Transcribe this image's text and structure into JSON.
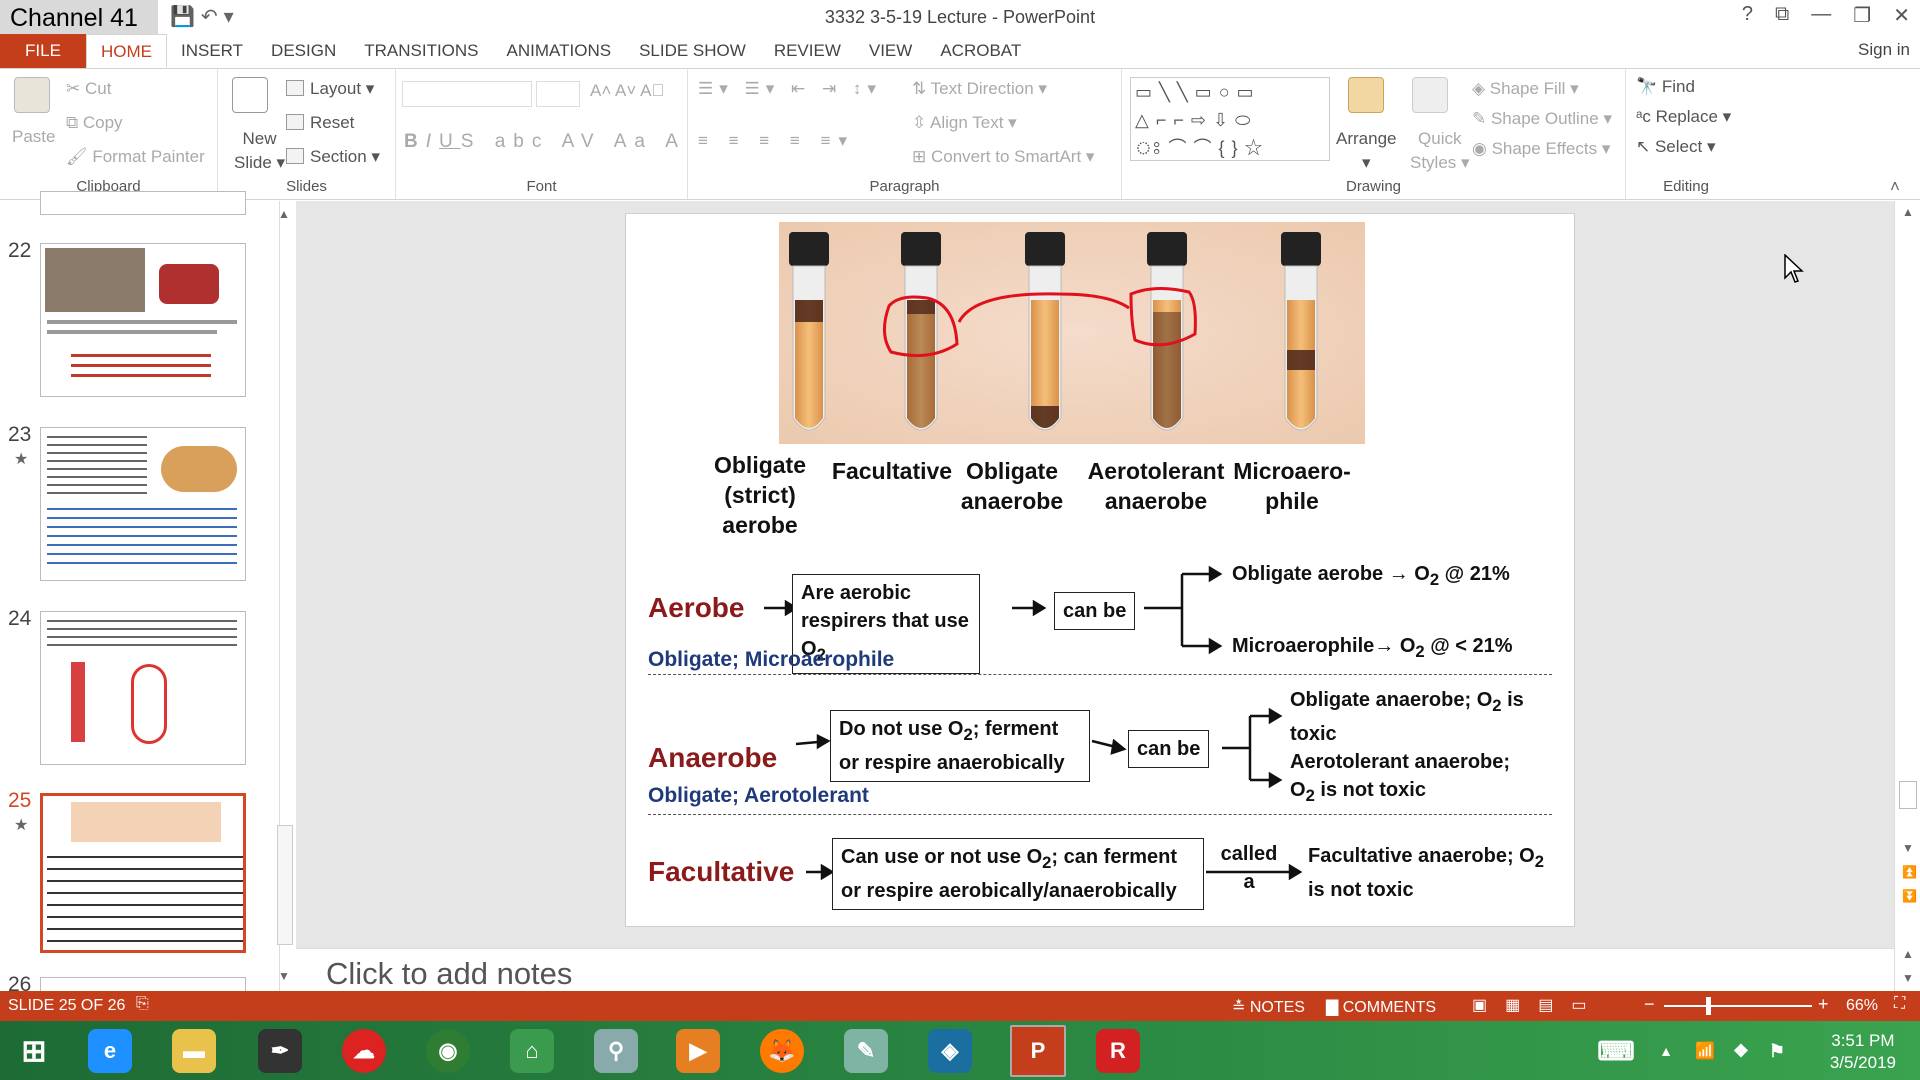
{
  "app": {
    "channel": "Channel 41",
    "window_title": "3332 3-5-19 Lecture - PowerPoint",
    "sign_in": "Sign in"
  },
  "tabs": [
    "FILE",
    "HOME",
    "INSERT",
    "DESIGN",
    "TRANSITIONS",
    "ANIMATIONS",
    "SLIDE SHOW",
    "REVIEW",
    "VIEW",
    "ACROBAT"
  ],
  "ribbon": {
    "clipboard": {
      "label": "Clipboard",
      "paste": "Paste",
      "cut": "Cut",
      "copy": "Copy",
      "format_painter": "Format Painter"
    },
    "slides": {
      "label": "Slides",
      "new_slide": "New",
      "new_slide2": "Slide",
      "layout": "Layout",
      "reset": "Reset",
      "section": "Section"
    },
    "font": {
      "label": "Font"
    },
    "paragraph": {
      "label": "Paragraph",
      "text_direction": "Text Direction",
      "align_text": "Align Text",
      "convert": "Convert to SmartArt"
    },
    "drawing": {
      "label": "Drawing",
      "arrange": "Arrange",
      "quick_styles": "Quick",
      "quick_styles2": "Styles",
      "shape_fill": "Shape Fill",
      "shape_outline": "Shape Outline",
      "shape_effects": "Shape Effects"
    },
    "editing": {
      "label": "Editing",
      "find": "Find",
      "replace": "Replace",
      "select": "Select"
    }
  },
  "thumbnails": [
    {
      "num": "22"
    },
    {
      "num": "23"
    },
    {
      "num": "24"
    },
    {
      "num": "25"
    },
    {
      "num": "26"
    }
  ],
  "slide": {
    "tubes": [
      {
        "label": "Obligate\n(strict)\naerobe"
      },
      {
        "label": "Facultative"
      },
      {
        "label": "Obligate\nanaerobe"
      },
      {
        "label": "Aerotolerant\nanaerobe"
      },
      {
        "label": "Microaero-\nphile"
      }
    ],
    "aerobe": {
      "title": "Aerobe",
      "sub": "Obligate;  Microaerophile",
      "box_l1": "Are aerobic",
      "box_l2": "respirers that use O",
      "canbe": "can be",
      "out1": "Obligate aerobe → O",
      "out1b": " @ 21%",
      "out2": "Microaerophile→ O",
      "out2b": " @ < 21%"
    },
    "anaerobe": {
      "title": "Anaerobe",
      "sub": "Obligate;  Aerotolerant",
      "box_l1a": "Do not use O",
      "box_l1b": "; ferment",
      "box_l2": "or respire anaerobically",
      "canbe": "can be",
      "out1a": "Obligate anaerobe; O",
      "out1b": " is",
      "out1c": "toxic",
      "out2a": "Aerotolerant anaerobe;",
      "out2b": "O",
      "out2c": " is not toxic"
    },
    "facultative": {
      "title": "Facultative",
      "box_l1a": "Can use or not use O",
      "box_l1b": "; can ferment",
      "box_l2": "or respire aerobically/anaerobically",
      "called": "called",
      "a": "a",
      "out1a": "Facultative anaerobe; O",
      "out2": "is not toxic"
    }
  },
  "notes_placeholder": "Click to add notes",
  "status": {
    "slide": "SLIDE 25 OF 26",
    "notes": "NOTES",
    "comments": "COMMENTS",
    "zoom": "66%"
  },
  "clock": {
    "time": "3:51 PM",
    "date": "3/5/2019"
  }
}
